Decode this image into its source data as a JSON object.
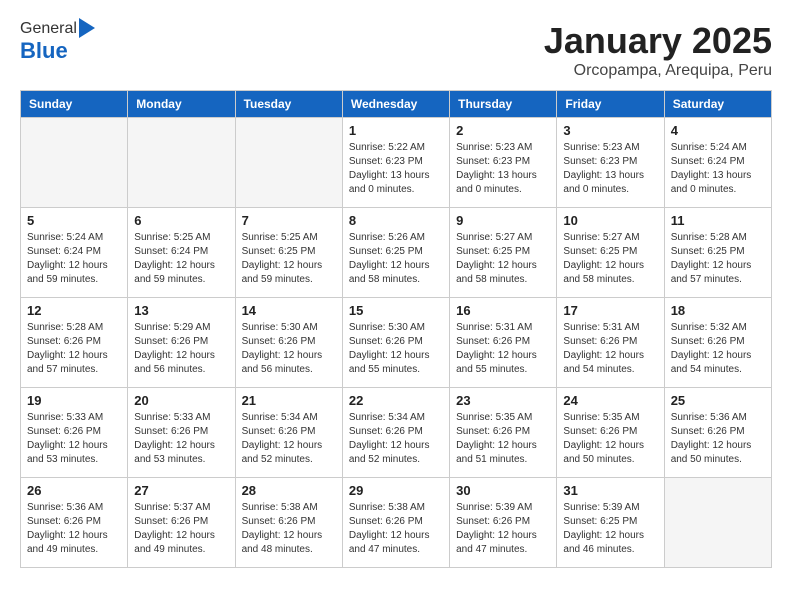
{
  "header": {
    "logo_general": "General",
    "logo_blue": "Blue",
    "month_title": "January 2025",
    "subtitle": "Orcopampa, Arequipa, Peru"
  },
  "weekdays": [
    "Sunday",
    "Monday",
    "Tuesday",
    "Wednesday",
    "Thursday",
    "Friday",
    "Saturday"
  ],
  "weeks": [
    [
      {
        "day": "",
        "info": ""
      },
      {
        "day": "",
        "info": ""
      },
      {
        "day": "",
        "info": ""
      },
      {
        "day": "1",
        "info": "Sunrise: 5:22 AM\nSunset: 6:23 PM\nDaylight: 13 hours\nand 0 minutes."
      },
      {
        "day": "2",
        "info": "Sunrise: 5:23 AM\nSunset: 6:23 PM\nDaylight: 13 hours\nand 0 minutes."
      },
      {
        "day": "3",
        "info": "Sunrise: 5:23 AM\nSunset: 6:23 PM\nDaylight: 13 hours\nand 0 minutes."
      },
      {
        "day": "4",
        "info": "Sunrise: 5:24 AM\nSunset: 6:24 PM\nDaylight: 13 hours\nand 0 minutes."
      }
    ],
    [
      {
        "day": "5",
        "info": "Sunrise: 5:24 AM\nSunset: 6:24 PM\nDaylight: 12 hours\nand 59 minutes."
      },
      {
        "day": "6",
        "info": "Sunrise: 5:25 AM\nSunset: 6:24 PM\nDaylight: 12 hours\nand 59 minutes."
      },
      {
        "day": "7",
        "info": "Sunrise: 5:25 AM\nSunset: 6:25 PM\nDaylight: 12 hours\nand 59 minutes."
      },
      {
        "day": "8",
        "info": "Sunrise: 5:26 AM\nSunset: 6:25 PM\nDaylight: 12 hours\nand 58 minutes."
      },
      {
        "day": "9",
        "info": "Sunrise: 5:27 AM\nSunset: 6:25 PM\nDaylight: 12 hours\nand 58 minutes."
      },
      {
        "day": "10",
        "info": "Sunrise: 5:27 AM\nSunset: 6:25 PM\nDaylight: 12 hours\nand 58 minutes."
      },
      {
        "day": "11",
        "info": "Sunrise: 5:28 AM\nSunset: 6:25 PM\nDaylight: 12 hours\nand 57 minutes."
      }
    ],
    [
      {
        "day": "12",
        "info": "Sunrise: 5:28 AM\nSunset: 6:26 PM\nDaylight: 12 hours\nand 57 minutes."
      },
      {
        "day": "13",
        "info": "Sunrise: 5:29 AM\nSunset: 6:26 PM\nDaylight: 12 hours\nand 56 minutes."
      },
      {
        "day": "14",
        "info": "Sunrise: 5:30 AM\nSunset: 6:26 PM\nDaylight: 12 hours\nand 56 minutes."
      },
      {
        "day": "15",
        "info": "Sunrise: 5:30 AM\nSunset: 6:26 PM\nDaylight: 12 hours\nand 55 minutes."
      },
      {
        "day": "16",
        "info": "Sunrise: 5:31 AM\nSunset: 6:26 PM\nDaylight: 12 hours\nand 55 minutes."
      },
      {
        "day": "17",
        "info": "Sunrise: 5:31 AM\nSunset: 6:26 PM\nDaylight: 12 hours\nand 54 minutes."
      },
      {
        "day": "18",
        "info": "Sunrise: 5:32 AM\nSunset: 6:26 PM\nDaylight: 12 hours\nand 54 minutes."
      }
    ],
    [
      {
        "day": "19",
        "info": "Sunrise: 5:33 AM\nSunset: 6:26 PM\nDaylight: 12 hours\nand 53 minutes."
      },
      {
        "day": "20",
        "info": "Sunrise: 5:33 AM\nSunset: 6:26 PM\nDaylight: 12 hours\nand 53 minutes."
      },
      {
        "day": "21",
        "info": "Sunrise: 5:34 AM\nSunset: 6:26 PM\nDaylight: 12 hours\nand 52 minutes."
      },
      {
        "day": "22",
        "info": "Sunrise: 5:34 AM\nSunset: 6:26 PM\nDaylight: 12 hours\nand 52 minutes."
      },
      {
        "day": "23",
        "info": "Sunrise: 5:35 AM\nSunset: 6:26 PM\nDaylight: 12 hours\nand 51 minutes."
      },
      {
        "day": "24",
        "info": "Sunrise: 5:35 AM\nSunset: 6:26 PM\nDaylight: 12 hours\nand 50 minutes."
      },
      {
        "day": "25",
        "info": "Sunrise: 5:36 AM\nSunset: 6:26 PM\nDaylight: 12 hours\nand 50 minutes."
      }
    ],
    [
      {
        "day": "26",
        "info": "Sunrise: 5:36 AM\nSunset: 6:26 PM\nDaylight: 12 hours\nand 49 minutes."
      },
      {
        "day": "27",
        "info": "Sunrise: 5:37 AM\nSunset: 6:26 PM\nDaylight: 12 hours\nand 49 minutes."
      },
      {
        "day": "28",
        "info": "Sunrise: 5:38 AM\nSunset: 6:26 PM\nDaylight: 12 hours\nand 48 minutes."
      },
      {
        "day": "29",
        "info": "Sunrise: 5:38 AM\nSunset: 6:26 PM\nDaylight: 12 hours\nand 47 minutes."
      },
      {
        "day": "30",
        "info": "Sunrise: 5:39 AM\nSunset: 6:26 PM\nDaylight: 12 hours\nand 47 minutes."
      },
      {
        "day": "31",
        "info": "Sunrise: 5:39 AM\nSunset: 6:25 PM\nDaylight: 12 hours\nand 46 minutes."
      },
      {
        "day": "",
        "info": ""
      }
    ]
  ]
}
